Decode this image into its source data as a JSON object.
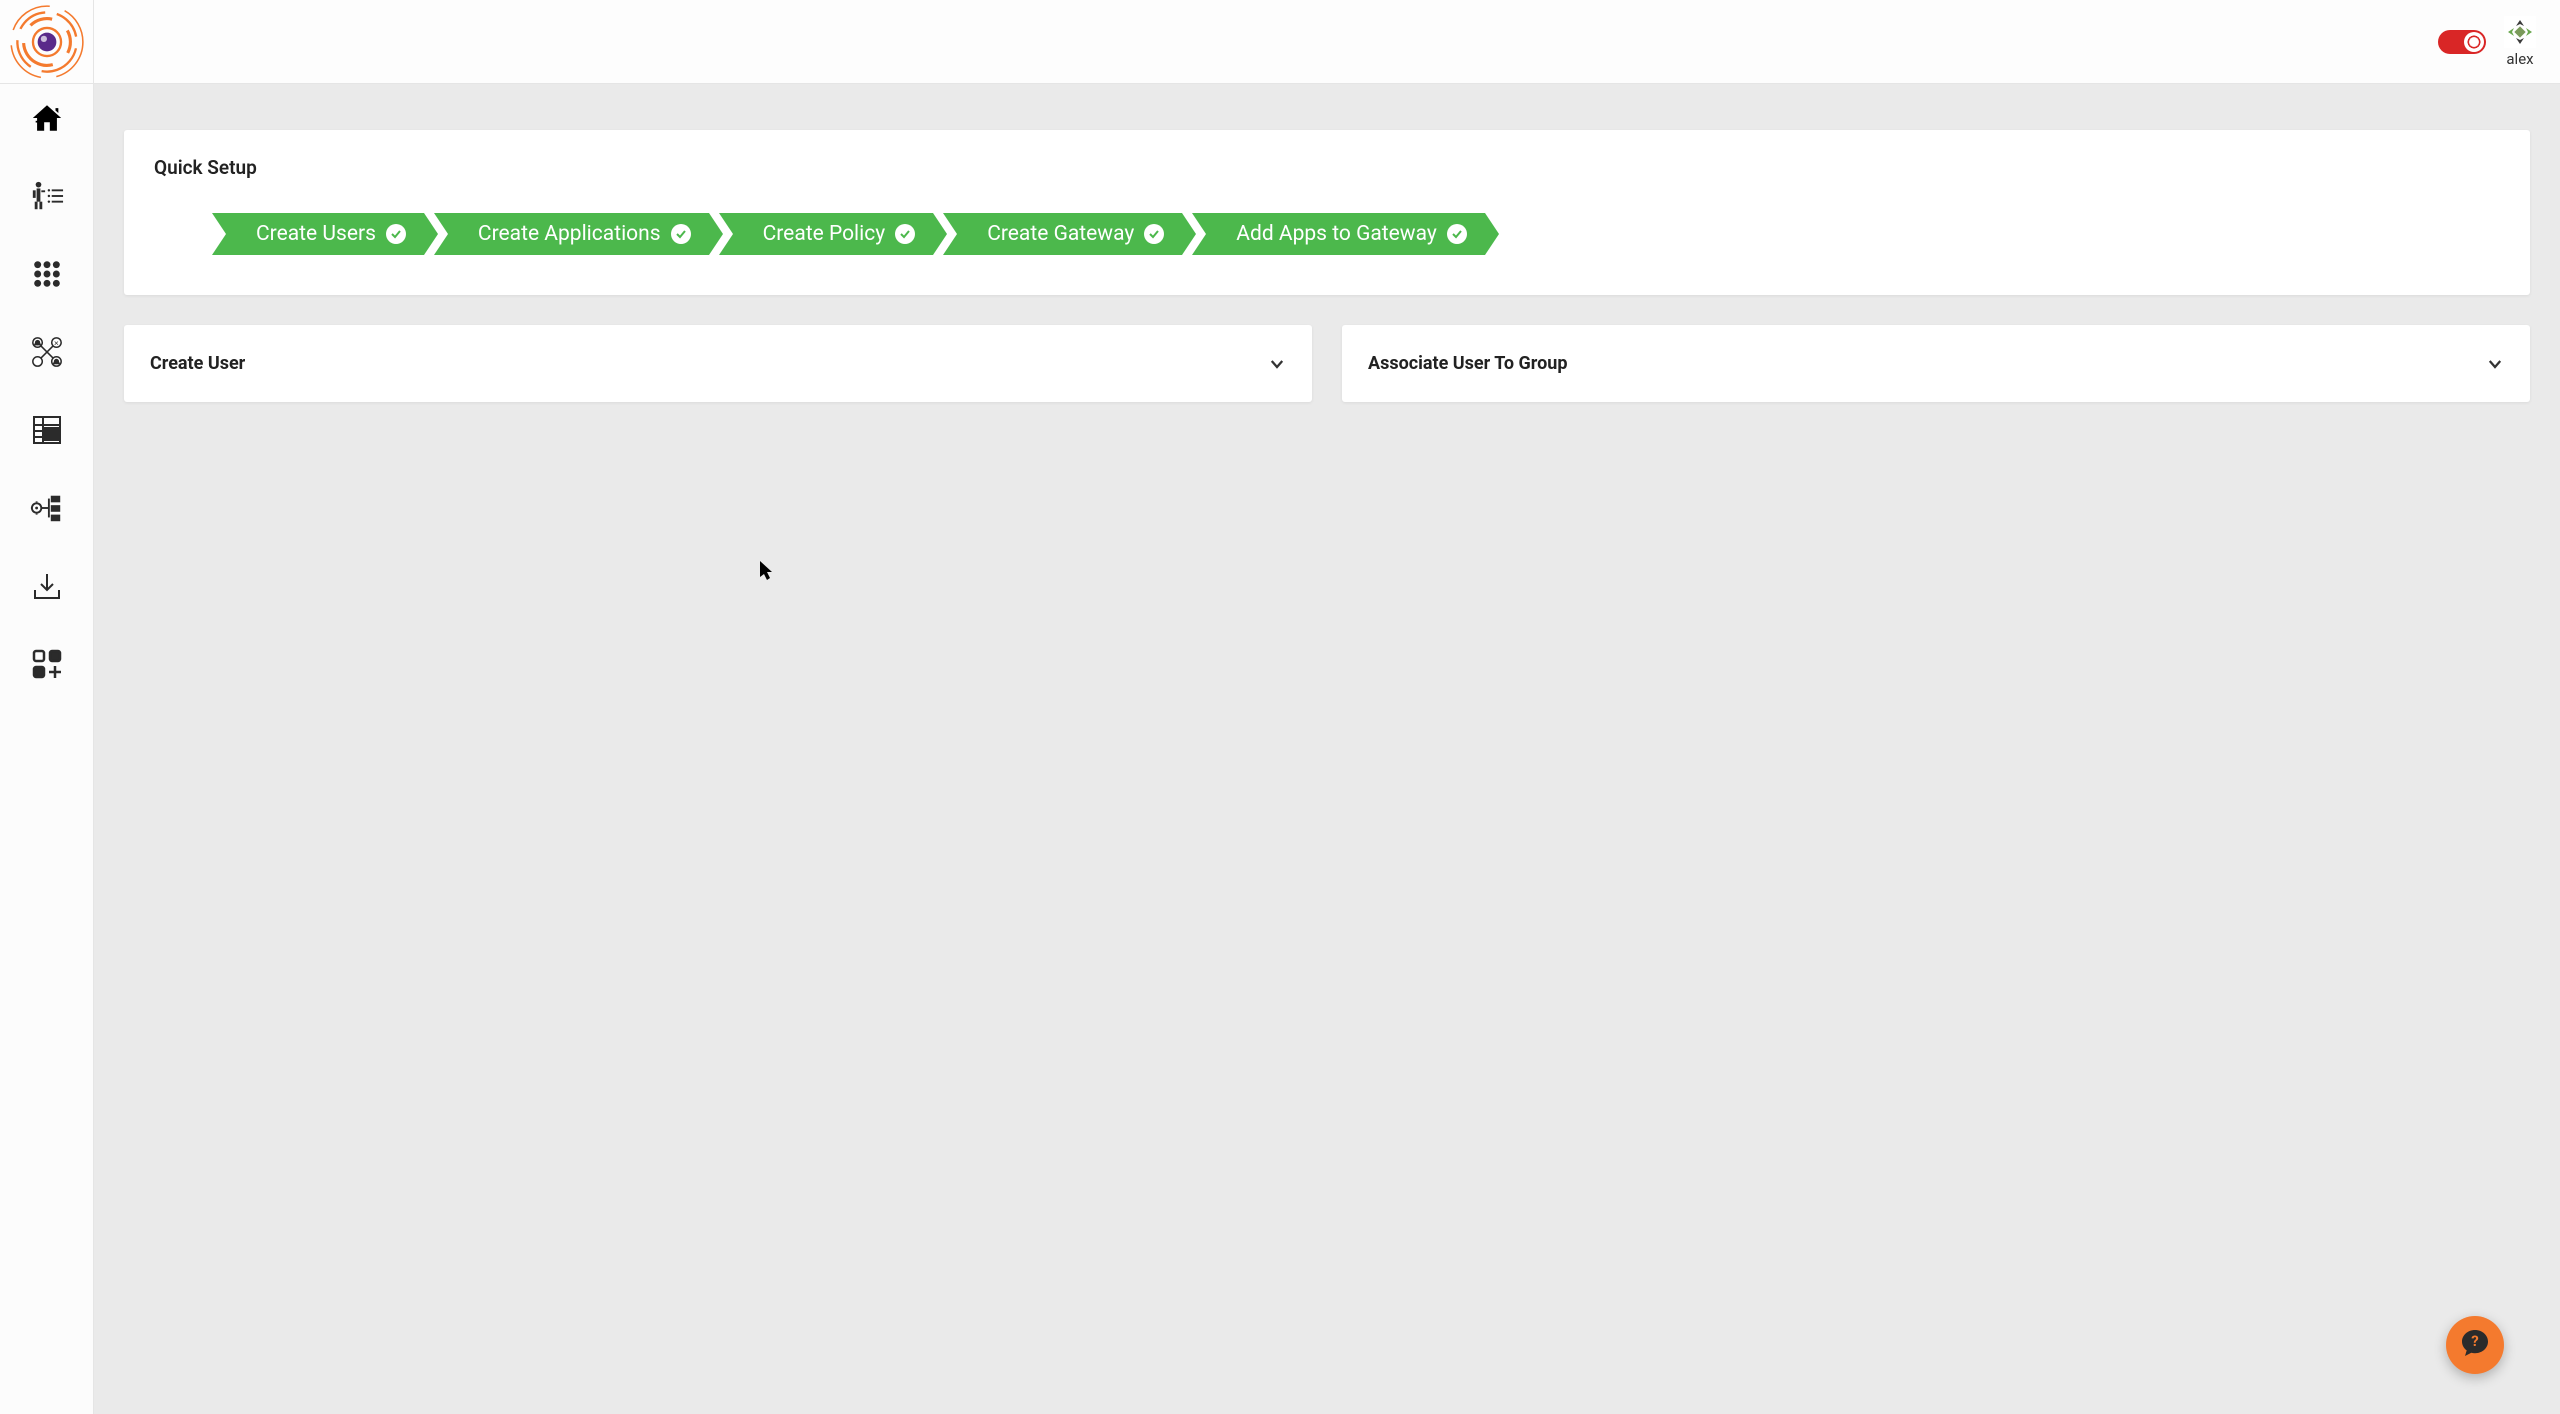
{
  "header": {
    "username": "alex"
  },
  "sidebar": {
    "items": [
      {
        "name": "home"
      },
      {
        "name": "onboarding"
      },
      {
        "name": "apps-grid"
      },
      {
        "name": "network"
      },
      {
        "name": "reports"
      },
      {
        "name": "settings"
      },
      {
        "name": "download"
      },
      {
        "name": "add-module"
      }
    ]
  },
  "quick_setup": {
    "title": "Quick Setup",
    "steps": [
      {
        "label": "Create Users",
        "done": true
      },
      {
        "label": "Create Applications",
        "done": true
      },
      {
        "label": "Create Policy",
        "done": true
      },
      {
        "label": "Create Gateway",
        "done": true
      },
      {
        "label": "Add Apps to Gateway",
        "done": true
      }
    ]
  },
  "panels": {
    "create_user": {
      "title": "Create User"
    },
    "associate_user_group": {
      "title": "Associate User To Group"
    }
  },
  "colors": {
    "accent_green": "#4cb84c",
    "accent_orange": "#f47a2e",
    "toggle_red": "#d92626"
  }
}
